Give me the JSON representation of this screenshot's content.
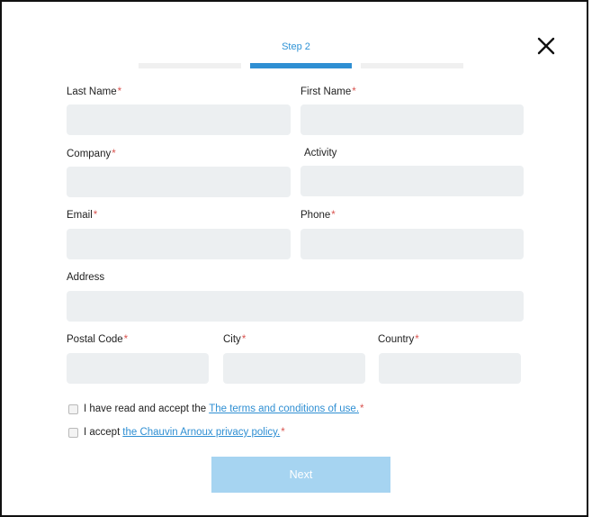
{
  "wizard": {
    "step_label": "Step 2",
    "total_steps": 3,
    "current_step": 2
  },
  "fields": {
    "last_name": {
      "label": "Last Name",
      "required_mark": "*",
      "value": ""
    },
    "first_name": {
      "label": "First Name",
      "required_mark": "*",
      "value": ""
    },
    "company": {
      "label": "Company",
      "required_mark": "*",
      "value": ""
    },
    "activity": {
      "label": "Activity",
      "value": ""
    },
    "email": {
      "label": "Email",
      "required_mark": "*",
      "value": ""
    },
    "phone": {
      "label": "Phone",
      "required_mark": "*",
      "value": ""
    },
    "address": {
      "label": "Address",
      "value": ""
    },
    "postal_code": {
      "label": "Postal Code",
      "required_mark": "*",
      "value": ""
    },
    "city": {
      "label": "City",
      "required_mark": "*",
      "value": ""
    },
    "country": {
      "label": "Country",
      "required_mark": "*",
      "value": ""
    }
  },
  "consents": {
    "terms": {
      "text": "I have read and accept the",
      "link": "The terms and conditions of use.",
      "required_mark": "*",
      "checked": false
    },
    "privacy": {
      "text": "I accept",
      "link": "the Chauvin Arnoux privacy policy.",
      "required_mark": "*",
      "checked": false
    }
  },
  "actions": {
    "next_label": "Next"
  },
  "icons": {
    "close": "close-icon"
  },
  "colors": {
    "accent": "#2f8fd3",
    "required": "#d9534f",
    "input_bg": "#eceff1",
    "button_disabled": "#a6d4f1"
  }
}
